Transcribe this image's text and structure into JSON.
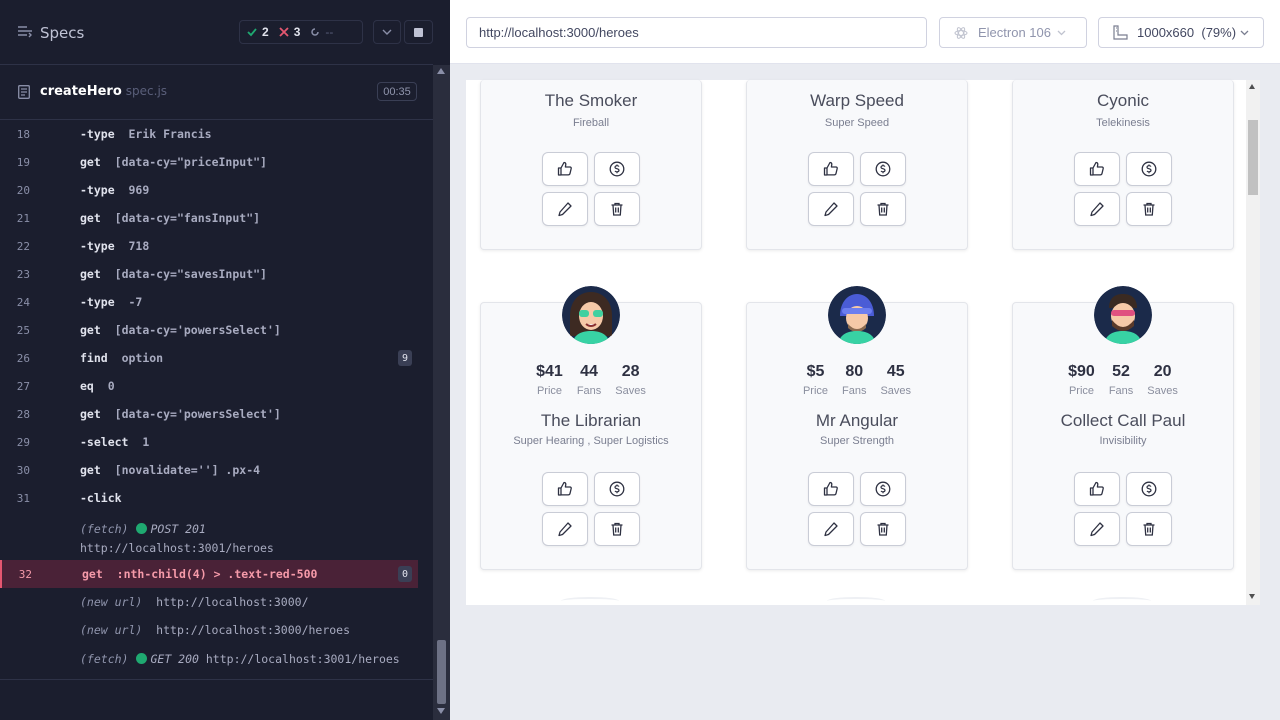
{
  "reporter": {
    "title": "Specs",
    "passed": "2",
    "failed": "3",
    "pending": "--",
    "spec_name": "createHero",
    "spec_ext": "spec.js",
    "duration": "00:35"
  },
  "commands": [
    {
      "line": "18",
      "name": "-type",
      "arg": "Erik Francis"
    },
    {
      "line": "19",
      "name": "get",
      "arg": "[data-cy=\"priceInput\"]"
    },
    {
      "line": "20",
      "name": "-type",
      "arg": "969"
    },
    {
      "line": "21",
      "name": "get",
      "arg": "[data-cy=\"fansInput\"]"
    },
    {
      "line": "22",
      "name": "-type",
      "arg": "718"
    },
    {
      "line": "23",
      "name": "get",
      "arg": "[data-cy=\"savesInput\"]"
    },
    {
      "line": "24",
      "name": "-type",
      "arg": "-7"
    },
    {
      "line": "25",
      "name": "get",
      "arg": "[data-cy='powersSelect']"
    },
    {
      "line": "26",
      "name": "find",
      "arg": "option",
      "badge": "9"
    },
    {
      "line": "27",
      "name": "eq",
      "arg": "0"
    },
    {
      "line": "28",
      "name": "get",
      "arg": "[data-cy='powersSelect']"
    },
    {
      "line": "29",
      "name": "-select",
      "arg": "1"
    },
    {
      "line": "30",
      "name": "get",
      "arg": "[novalidate=''] .px-4"
    },
    {
      "line": "31",
      "name": "-click",
      "arg": ""
    }
  ],
  "logs": {
    "fetch1": {
      "kind": "(fetch)",
      "method": "POST 201",
      "url": "http://localhost:3001/heroes"
    },
    "failed": {
      "line": "32",
      "name": "get",
      "arg": ":nth-child(4) > .text-red-500",
      "badge": "0"
    },
    "newurl1": {
      "kind": "(new url)",
      "url": "http://localhost:3000/"
    },
    "newurl2": {
      "kind": "(new url)",
      "url": "http://localhost:3000/heroes"
    },
    "fetch2": {
      "kind": "(fetch)",
      "method": "GET 200",
      "url": "http://localhost:3001/heroes"
    }
  },
  "browser": {
    "url": "http://localhost:3000/heroes",
    "browser_name": "Electron 106",
    "viewport": "1000x660",
    "zoom": "(79%)"
  },
  "heroes_top": [
    {
      "name": "The Smoker",
      "powers": "Fireball"
    },
    {
      "name": "Warp Speed",
      "powers": "Super Speed"
    },
    {
      "name": "Cyonic",
      "powers": "Telekinesis"
    }
  ],
  "heroes": [
    {
      "name": "The Librarian",
      "powers": "Super Hearing ,  Super Logistics",
      "price": "$41",
      "fans": "44",
      "saves": "28"
    },
    {
      "name": "Mr Angular",
      "powers": "Super Strength",
      "price": "$5",
      "fans": "80",
      "saves": "45"
    },
    {
      "name": "Collect Call Paul",
      "powers": "Invisibility",
      "price": "$90",
      "fans": "52",
      "saves": "20"
    }
  ],
  "labels": {
    "price": "Price",
    "fans": "Fans",
    "saves": "Saves"
  },
  "colors": {
    "pass": "#1fa971",
    "fail": "#e45770",
    "sidebar_bg": "#1b1e2e",
    "accent_failed_bg": "#4a2237"
  }
}
